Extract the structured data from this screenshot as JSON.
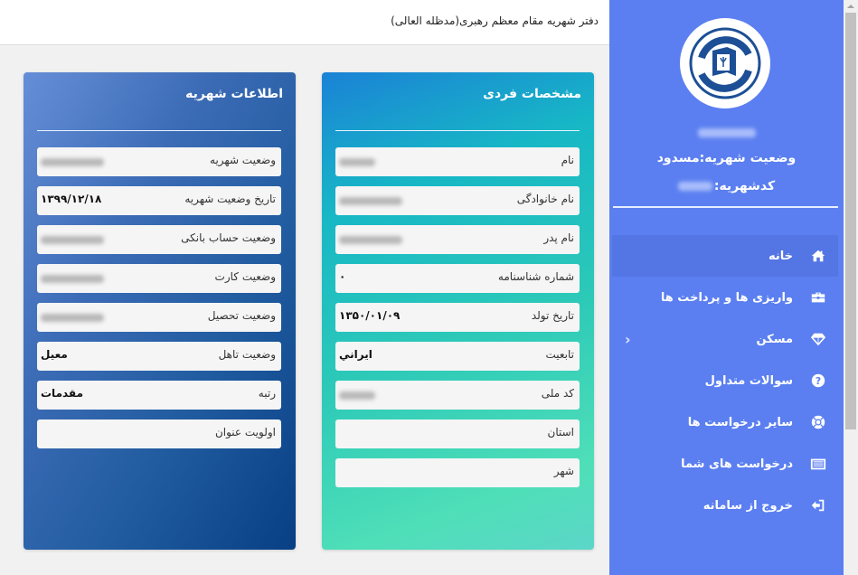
{
  "header": {
    "title": "دفتر شهریه مقام معظم رهبری(مدظله العالی)"
  },
  "sidebar": {
    "logo_icon": "org-logo",
    "user_name": "",
    "status_line": "وضعیت شهریه:مسدود",
    "code_label": "کدشهریه:",
    "nav": [
      {
        "label": "خانه",
        "icon": "home-icon",
        "active": true
      },
      {
        "label": "واریزی ها و پرداخت ها",
        "icon": "briefcase-icon"
      },
      {
        "label": "مسکن",
        "icon": "diamond-icon",
        "has_submenu": true
      },
      {
        "label": "سوالات متداول",
        "icon": "question-circle-icon"
      },
      {
        "label": "سایر درخواست ها",
        "icon": "life-ring-icon"
      },
      {
        "label": "درخواست های شما",
        "icon": "list-icon"
      },
      {
        "label": "خروج از سامانه",
        "icon": "sign-out-icon"
      }
    ],
    "submenu_chevron": "‹"
  },
  "personal_card": {
    "title": "مشخصات فردی",
    "fields": [
      {
        "label": "نام",
        "value": "",
        "blurred": true
      },
      {
        "label": "نام خانوادگی",
        "value": "",
        "blurred": true
      },
      {
        "label": "نام پدر",
        "value": "",
        "blurred": true
      },
      {
        "label": "شماره شناسنامه",
        "value": "۰"
      },
      {
        "label": "تاریخ تولد",
        "value": "۱۳۵۰/۰۱/۰۹"
      },
      {
        "label": "تابعیت",
        "value": "ايراني"
      },
      {
        "label": "کد ملی",
        "value": "",
        "blurred": true
      },
      {
        "label": "استان",
        "value": ""
      },
      {
        "label": "شهر",
        "value": ""
      }
    ]
  },
  "tuition_card": {
    "title": "اطلاعات شهریه",
    "fields": [
      {
        "label": "وضعیت شهریه",
        "value": "",
        "blurred": true
      },
      {
        "label": "تاریخ وضعیت شهریه",
        "value": "۱۳۹۹/۱۲/۱۸"
      },
      {
        "label": "وضعیت حساب بانکی",
        "value": "",
        "blurred": true
      },
      {
        "label": "وضعیت کارت",
        "value": "",
        "blurred": true
      },
      {
        "label": "وضعیت تحصیل",
        "value": "",
        "blurred": true
      },
      {
        "label": "وضعیت تاهل",
        "value": "معیل"
      },
      {
        "label": "رتبه",
        "value": "مقدمات"
      },
      {
        "label": "اولویت عنوان",
        "value": ""
      }
    ]
  },
  "colors": {
    "sidebar_bg": "#5b7ff0",
    "sidebar_active": "#5475e4",
    "page_bg": "#f1f1f1"
  }
}
